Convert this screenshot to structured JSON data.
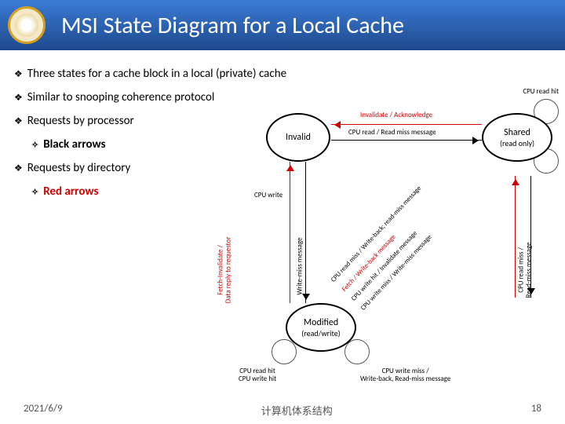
{
  "header": {
    "title": "MSI State Diagram for a Local Cache"
  },
  "bullets": {
    "b1": "Three states for a cache block in a local (private) cache",
    "b2": "Similar to snooping coherence protocol",
    "b3": "Requests by processor",
    "b3a": "Black arrows",
    "b4": "Requests by directory",
    "b4a": "Red arrows"
  },
  "states": {
    "invalid": {
      "name": "Invalid"
    },
    "shared": {
      "name": "Shared",
      "sub": "(read only)"
    },
    "modified": {
      "name": "Modified",
      "sub": "(read/write)"
    }
  },
  "labels": {
    "invalidate_ack": "Invalidate / Acknowledge",
    "cpu_read_readmiss": "CPU read / Read miss message",
    "cpu_read_hit_shared": "CPU read hit",
    "cpu_write": "CPU write",
    "modified_loop_left": "CPU read hit\nCPU write hit",
    "modified_loop_right": "CPU write miss /\nWrite-back, Read-miss message",
    "left_vertical_red": "Fetch-Invalidate /\nData reply to requestor",
    "left_vertical_black": "Write-miss message",
    "right_vertical_black": "CPU read miss /\nRead-miss message",
    "diag1": "CPU read miss / Write-back; read-miss message",
    "diag2": "Fetch / Write-back message",
    "diag3": "CPU write hit / Invalidate message",
    "diag4": "CPU write miss / Write-miss message"
  },
  "footer": {
    "date": "2021/6/9",
    "center": "计算机体系结构",
    "page": "18"
  }
}
